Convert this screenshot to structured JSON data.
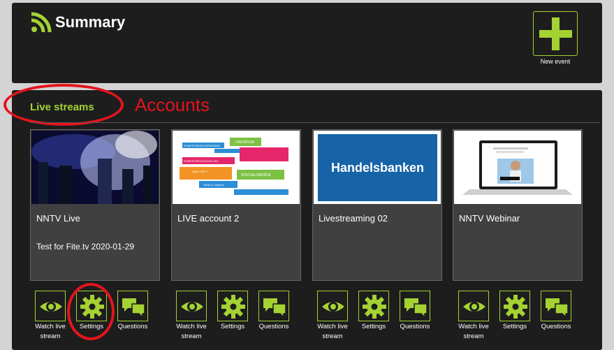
{
  "summary": {
    "title": "Summary",
    "new_event_label": "New event"
  },
  "section": {
    "tab_label": "Live streams",
    "annotation": "Accounts"
  },
  "cards": [
    {
      "title": "NNTV Live",
      "desc": "Test for Fite.tv 2020-01-29"
    },
    {
      "title": "LIVE account 2",
      "desc": ""
    },
    {
      "title": "Livestreaming 02",
      "desc": ""
    },
    {
      "title": "NNTV Webinar",
      "desc": ""
    }
  ],
  "thumb2_words": [
    "KOMPETENCEVURDERING",
    "VISITATION",
    "KOMPETENCEUDVIKLING",
    "ANALYSE &",
    "SPECIALOMRÅDE",
    "Skole & Ungdom"
  ],
  "bank_name": "Handelsbanken",
  "actions": {
    "watch": "Watch live stream",
    "settings": "Settings",
    "questions": "Questions"
  },
  "colors": {
    "accent": "#a4d233",
    "panel": "#1d1d1d",
    "annotation": "#e4141c"
  }
}
